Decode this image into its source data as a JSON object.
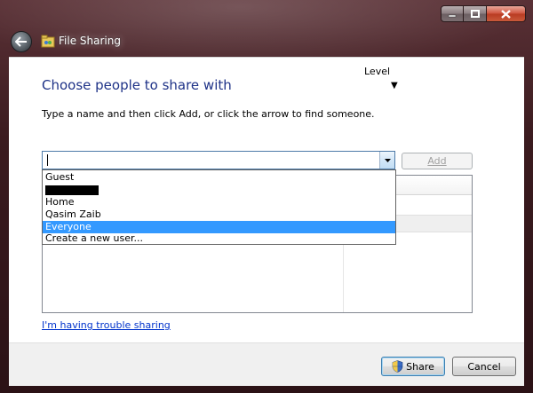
{
  "window": {
    "title": "File Sharing",
    "back_icon": "back-arrow-icon",
    "app_icon": "file-sharing-icon"
  },
  "caption_buttons": {
    "minimize_icon": "minimize-icon",
    "maximize_icon": "maximize-icon",
    "close_icon": "close-icon"
  },
  "main": {
    "heading": "Choose people to share with",
    "instruction": "Type a name and then click Add, or click the arrow to find someone.",
    "combo": {
      "value": ""
    },
    "add_button": {
      "label": "Add",
      "enabled": false
    }
  },
  "dropdown": {
    "items": [
      {
        "label": "Guest",
        "selected": false
      },
      {
        "label": "",
        "redacted": true
      },
      {
        "label": "Home",
        "selected": false
      },
      {
        "label": "Qasim Zaib",
        "selected": false
      },
      {
        "label": "Everyone",
        "selected": true
      },
      {
        "label": "Create a new user...",
        "selected": false
      }
    ],
    "selected_color": "#3399ff"
  },
  "list": {
    "column_header_partial": "Level",
    "permission_arrow": "▼"
  },
  "links": {
    "trouble": "I'm having trouble sharing"
  },
  "footer": {
    "share_label": "Share",
    "cancel_label": "Cancel",
    "share_icon": "uac-shield-icon"
  },
  "colors": {
    "heading": "#1e3287",
    "link": "#0033cc"
  }
}
